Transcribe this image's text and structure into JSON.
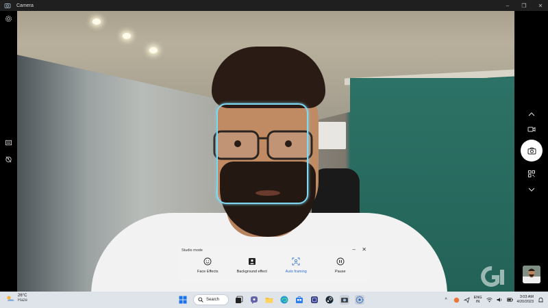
{
  "window": {
    "title": "Camera",
    "icon": "camera-app-icon",
    "controls": [
      "minimize-icon",
      "restore-icon",
      "close-icon"
    ]
  },
  "left_rail": {
    "items": [
      "settings-icon",
      "photo-mode-icon",
      "timer-icon"
    ]
  },
  "right_rail": {
    "items": [
      "chevron-up-icon",
      "video-mode-icon",
      "camera-shutter-icon",
      "qr-scan-icon",
      "chevron-down-icon",
      "last-capture-thumbnail"
    ]
  },
  "studio_mode": {
    "title": "Studio mode",
    "minimize_glyph": "–",
    "close_glyph": "✕",
    "items": [
      {
        "label": "Face Effects",
        "icon": "smiley-icon",
        "active": false
      },
      {
        "label": "Background effect",
        "icon": "portrait-icon",
        "active": false
      },
      {
        "label": "Auto framing",
        "icon": "auto-framing-icon",
        "active": true
      },
      {
        "label": "Pause",
        "icon": "pause-icon",
        "active": false
      }
    ],
    "accent_color": "#2a6fd1"
  },
  "face_tracking": {
    "color": "#7fd9f5"
  },
  "taskbar": {
    "weather": {
      "temp": "26°C",
      "condition": "Haze"
    },
    "search_label": "Search",
    "apps": [
      "windows-start-icon",
      "search-icon",
      "task-view-icon",
      "teams-icon",
      "file-explorer-icon",
      "edge-icon",
      "store-icon",
      "app-icon",
      "steam-icon",
      "camera-app-icon",
      "settings-app-icon"
    ],
    "tray": {
      "language_line1": "ENG",
      "language_line2": "IN",
      "time": "3:03 AM",
      "date": "4/20/2023"
    }
  }
}
